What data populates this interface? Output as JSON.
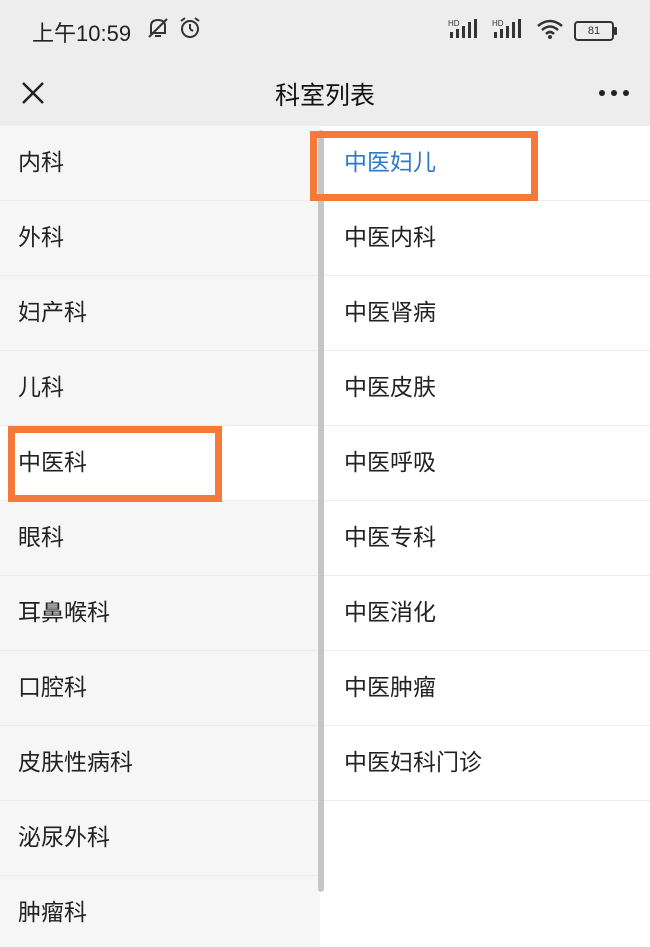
{
  "status_bar": {
    "time": "上午10:59",
    "battery": "81",
    "icons": [
      "mute-icon",
      "alarm-icon",
      "signal-hd-icon",
      "signal-hd-icon",
      "wifi-icon",
      "battery-icon"
    ]
  },
  "nav": {
    "title": "科室列表",
    "close_icon": "close-icon",
    "more_icon": "more-icon"
  },
  "left_list": {
    "items": [
      {
        "label": "内科"
      },
      {
        "label": "外科"
      },
      {
        "label": "妇产科"
      },
      {
        "label": "儿科"
      },
      {
        "label": "中医科",
        "selected": true
      },
      {
        "label": "眼科"
      },
      {
        "label": "耳鼻喉科"
      },
      {
        "label": "口腔科"
      },
      {
        "label": "皮肤性病科"
      },
      {
        "label": "泌尿外科"
      },
      {
        "label": "肿瘤科"
      }
    ]
  },
  "right_list": {
    "items": [
      {
        "label": "中医妇儿",
        "selected": true
      },
      {
        "label": "中医内科"
      },
      {
        "label": "中医肾病"
      },
      {
        "label": "中医皮肤"
      },
      {
        "label": "中医呼吸"
      },
      {
        "label": "中医专科"
      },
      {
        "label": "中医消化"
      },
      {
        "label": "中医肿瘤"
      },
      {
        "label": "中医妇科门诊"
      }
    ]
  },
  "colors": {
    "highlight_box": "#f57a3a",
    "selected_text": "#2f78c8",
    "bar_background": "#ededed",
    "left_background": "#f6f6f6"
  }
}
